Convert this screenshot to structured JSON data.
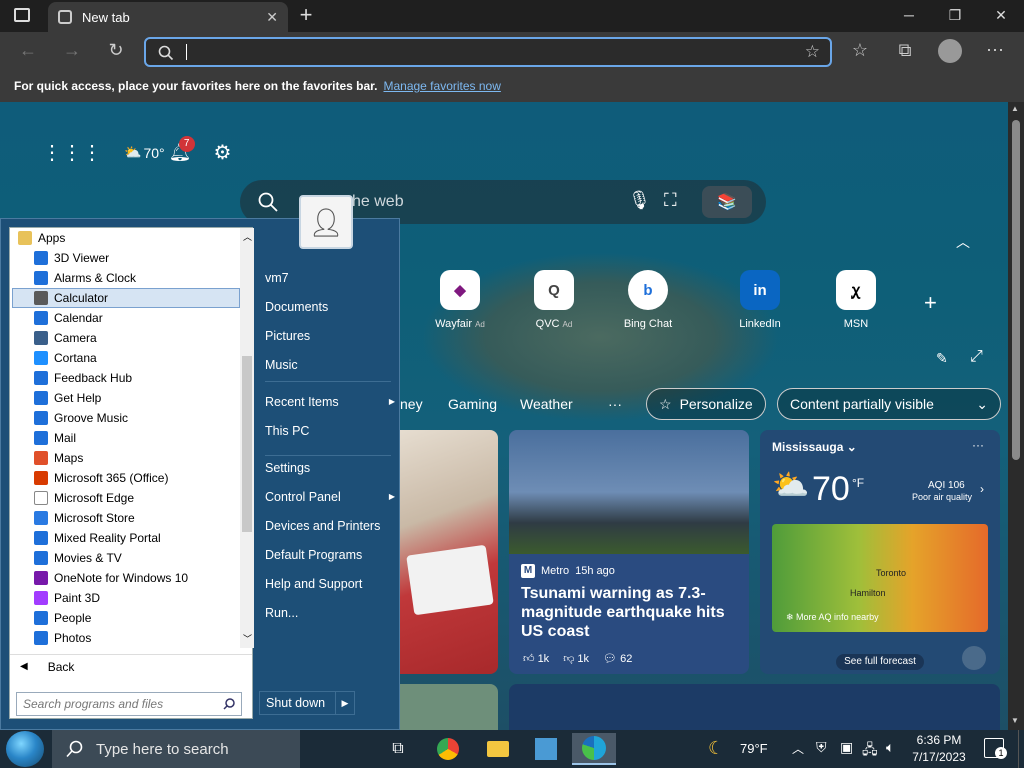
{
  "browser": {
    "tab_title": "New tab",
    "favbar_text": "For quick access, place your favorites here on the favorites bar.",
    "favbar_link": "Manage favorites now",
    "address_placeholder": ""
  },
  "newtab": {
    "weather_temp_short": "70°",
    "notifications_count": "7",
    "search_placeholder": "he web",
    "tiles": [
      {
        "label": "Wayfair",
        "ad": "Ad"
      },
      {
        "label": "QVC",
        "ad": "Ad"
      },
      {
        "label": "Bing Chat",
        "ad": ""
      },
      {
        "label": "LinkedIn",
        "ad": ""
      },
      {
        "label": "MSN",
        "ad": ""
      }
    ],
    "nav": [
      "ney",
      "Gaming",
      "Weather",
      "···"
    ],
    "personalize": "Personalize",
    "content_visibility": "Content partially visible",
    "news": {
      "source": "Metro",
      "age": "15h ago",
      "headline": "Tsunami warning as 7.3-magnitude earthquake hits US coast",
      "likes": "1k",
      "dislikes": "1k",
      "comments": "62"
    },
    "weather": {
      "city": "Mississauga",
      "temp": "70",
      "unit": "°F",
      "aqi": "AQI 106",
      "aqi_text": "Poor air quality",
      "map_label_1": "Toronto",
      "map_label_2": "Hamilton",
      "more_aq": "More AQ info nearby",
      "forecast_btn": "See full forecast"
    }
  },
  "startmenu": {
    "apps_header": "Apps",
    "apps": [
      {
        "label": "3D Viewer",
        "color": "#1e6fd9"
      },
      {
        "label": "Alarms & Clock",
        "color": "#1e6fd9"
      },
      {
        "label": "Calculator",
        "color": "#5a5a5a"
      },
      {
        "label": "Calendar",
        "color": "#1e6fd9"
      },
      {
        "label": "Camera",
        "color": "#3a5f8a"
      },
      {
        "label": "Cortana",
        "color": "#1e90ff"
      },
      {
        "label": "Feedback Hub",
        "color": "#1e6fd9"
      },
      {
        "label": "Get Help",
        "color": "#1e6fd9"
      },
      {
        "label": "Groove Music",
        "color": "#1e6fd9"
      },
      {
        "label": "Mail",
        "color": "#1e6fd9"
      },
      {
        "label": "Maps",
        "color": "#e0502a"
      },
      {
        "label": "Microsoft 365 (Office)",
        "color": "#d83b01"
      },
      {
        "label": "Microsoft Edge",
        "color": "#ffffff"
      },
      {
        "label": "Microsoft Store",
        "color": "#2a7ae2"
      },
      {
        "label": "Mixed Reality Portal",
        "color": "#1e6fd9"
      },
      {
        "label": "Movies & TV",
        "color": "#1e6fd9"
      },
      {
        "label": "OneNote for Windows 10",
        "color": "#7719aa"
      },
      {
        "label": "Paint 3D",
        "color": "#a23cff"
      },
      {
        "label": "People",
        "color": "#1e6fd9"
      },
      {
        "label": "Photos",
        "color": "#1e6fd9"
      }
    ],
    "selected_app": "Calculator",
    "back": "Back",
    "search_placeholder": "Search programs and files",
    "right_items": [
      {
        "label": "vm7",
        "arrow": false
      },
      {
        "label": "Documents",
        "arrow": false
      },
      {
        "label": "Pictures",
        "arrow": false
      },
      {
        "label": "Music",
        "arrow": false
      },
      {
        "label": "Recent Items",
        "arrow": true
      },
      {
        "label": "This PC",
        "arrow": false
      },
      {
        "label": "Settings",
        "arrow": false
      },
      {
        "label": "Control Panel",
        "arrow": true
      },
      {
        "label": "Devices and Printers",
        "arrow": false
      },
      {
        "label": "Default Programs",
        "arrow": false
      },
      {
        "label": "Help and Support",
        "arrow": false
      },
      {
        "label": "Run...",
        "arrow": false
      }
    ],
    "shutdown": "Shut down"
  },
  "taskbar": {
    "search_text": "Type here to search",
    "weather_temp": "79°F",
    "time": "6:36 PM",
    "date": "7/17/2023",
    "notif_count": "1"
  }
}
